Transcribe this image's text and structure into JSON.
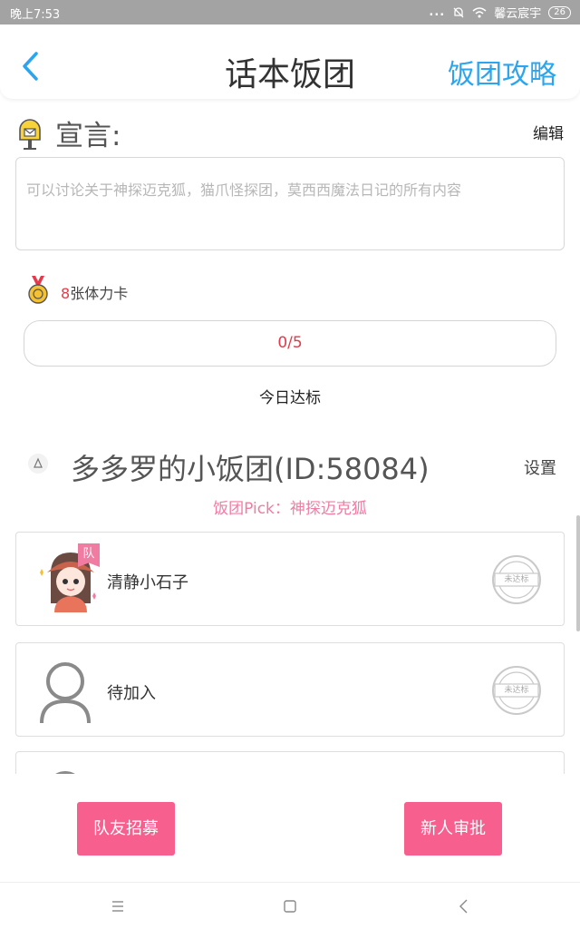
{
  "status_bar": {
    "time": "晚上7:53",
    "dots": "...",
    "carrier": "馨云宸宇",
    "battery": "26"
  },
  "header": {
    "title": "话本饭团",
    "guide_link": "饭团攻略",
    "accent_color": "#2ba5ee"
  },
  "declaration": {
    "label": "宣言:",
    "edit": "编辑",
    "placeholder": "可以讨论关于神探迈克狐，猫爪怪探团，莫西西魔法日记的所有内容"
  },
  "stamina": {
    "count": "8",
    "label": "张体力卡"
  },
  "progress": {
    "value": "0/5",
    "caption": "今日达标"
  },
  "team": {
    "name": "多多罗的小饭团(ID:58084)",
    "settings": "设置",
    "pick": "饭团Pick：神探迈克狐"
  },
  "members": [
    {
      "name": "清静小石子",
      "badge": "队",
      "stamp": "未达标",
      "avatar": "girl-avatar"
    },
    {
      "name": "待加入",
      "stamp": "未达标",
      "avatar": "person-placeholder"
    },
    {
      "name": "",
      "avatar": "person-placeholder"
    }
  ],
  "actions": {
    "recruit": "队友招募",
    "approve": "新人审批",
    "button_color": "#f65f8e"
  },
  "nav": {
    "icons": [
      "menu-icon",
      "home-icon",
      "back-icon"
    ]
  }
}
